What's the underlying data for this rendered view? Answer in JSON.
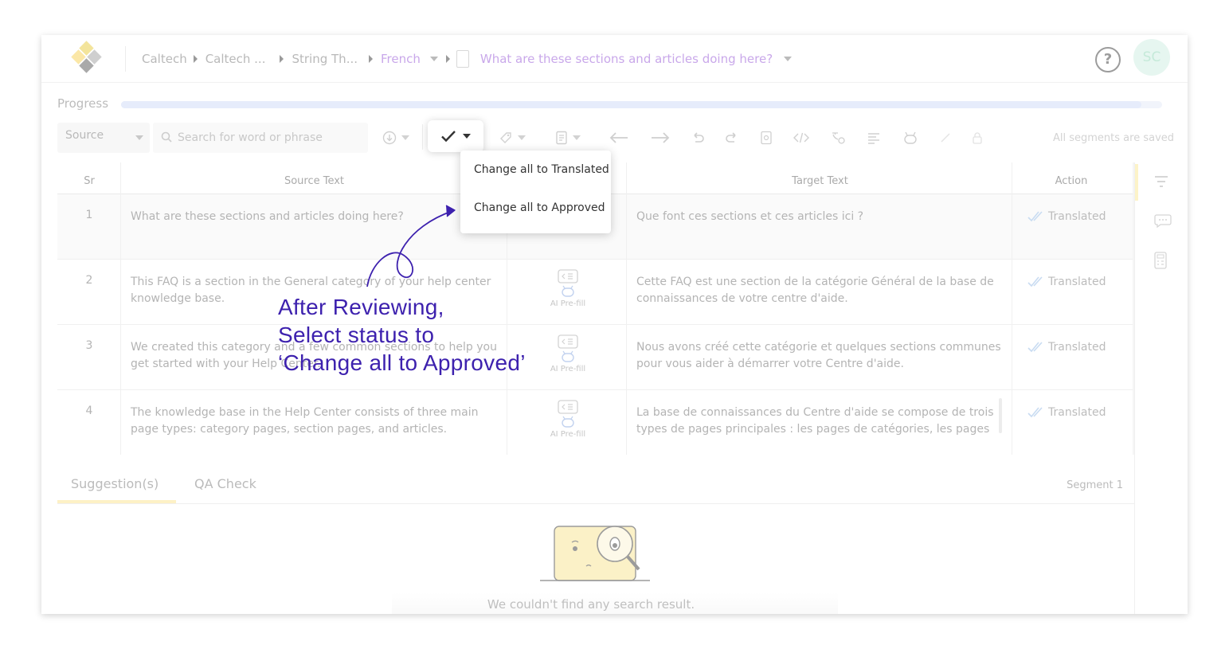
{
  "breadcrumb": {
    "items": [
      "Caltech",
      "Caltech ...",
      "String Th..."
    ],
    "language": "French",
    "document_title": "What are these sections and articles doing here?"
  },
  "header": {
    "help_label": "?",
    "avatar_initials": "SC"
  },
  "progress": {
    "label": "Progress",
    "value": 0.98
  },
  "toolbar": {
    "source_select_value": "Source",
    "search_placeholder": "Search for word or phrase",
    "save_status": "All segments are saved",
    "icons": [
      "download-icon",
      "checkmark-icon",
      "tag-icon",
      "document-icon",
      "arrow-left-icon",
      "arrow-right-icon",
      "undo-icon",
      "redo-icon",
      "find-icon",
      "code-icon",
      "translate-icon",
      "align-icon",
      "robot-icon",
      "magic-icon",
      "lock-icon"
    ]
  },
  "status_dropdown": {
    "items": [
      "Change all to Translated",
      "Change all to Approved"
    ]
  },
  "table": {
    "headers": [
      "Sr",
      "Source Text",
      "Target Text",
      "Action"
    ],
    "prefill_label": "AI Pre-fill",
    "rows": [
      {
        "sr": "1",
        "source": "What are these sections and articles doing here?",
        "target": "Que font ces sections et ces articles ici ?",
        "status": "Translated"
      },
      {
        "sr": "2",
        "source": "This FAQ is a section in the General category of your help center knowledge base.",
        "target": "Cette FAQ est une section de la catégorie Général de la base de connaissances de votre centre d'aide.",
        "status": "Translated"
      },
      {
        "sr": "3",
        "source": "We created this category and a few common sections to help you get started with your Help Center.",
        "target": "Nous avons créé cette catégorie et quelques sections communes pour vous aider à démarrer votre Centre d'aide.",
        "status": "Translated"
      },
      {
        "sr": "4",
        "source": "The knowledge base in the Help Center consists of three main page types: category pages, section pages, and articles.",
        "target": "La base de connaissances du Centre d'aide se compose de trois types de pages principales : les pages de catégories, les pages",
        "status": "Translated"
      }
    ]
  },
  "bottom_panel": {
    "tabs": [
      "Suggestion(s)",
      "QA Check"
    ],
    "segment_label": "Segment 1",
    "empty_message": "We couldn't find any search result."
  },
  "annotation": {
    "lines": [
      "After Reviewing,",
      "Select status to",
      "‘Change all to Approved’"
    ]
  },
  "colors": {
    "accent_purple": "#c9a8ea",
    "annotation": "#3d21ae",
    "tab_underline": "#fdf1c6",
    "avatar_bg": "#e6f6f0"
  }
}
